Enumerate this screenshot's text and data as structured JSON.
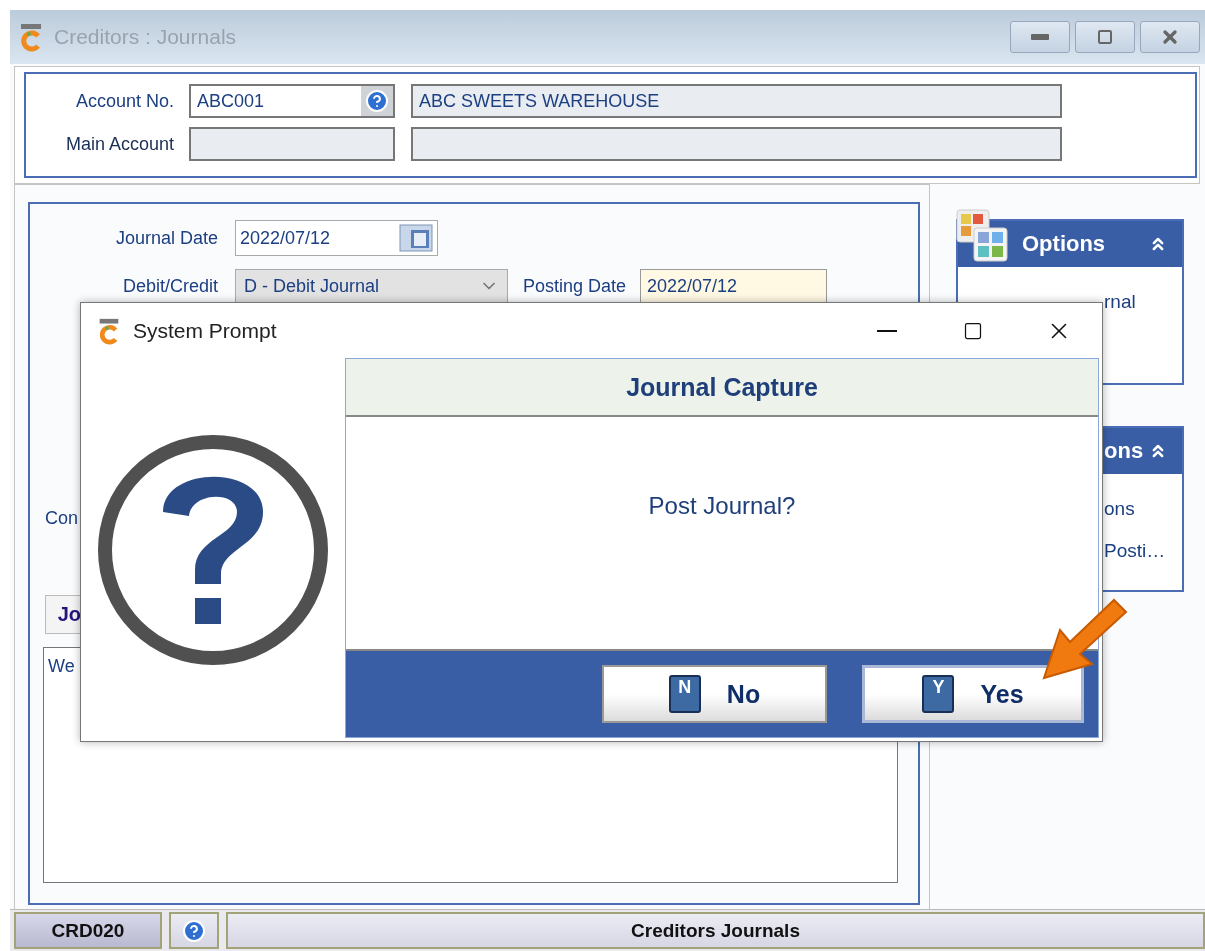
{
  "window": {
    "title": "Creditors : Journals"
  },
  "account": {
    "account_no_label": "Account No.",
    "account_no": "ABC001",
    "account_name": "ABC SWEETS WAREHOUSE",
    "main_account_label": "Main Account"
  },
  "journal": {
    "journal_date_label": "Journal Date",
    "journal_date": "2022/07/12",
    "debit_credit_label": "Debit/Credit",
    "debit_credit": "D - Debit Journal",
    "posting_date_label": "Posting Date",
    "posting_date": "2022/07/12",
    "partial_label": "Con",
    "tab": "Jo",
    "notes": "We"
  },
  "sidebar": {
    "panels": [
      {
        "title": "Options",
        "expanded": true,
        "items": [
          "rnal"
        ]
      },
      {
        "title": "ons",
        "expanded": true,
        "items": [
          "ons",
          "Posti…"
        ]
      }
    ]
  },
  "dialog": {
    "title": "System Prompt",
    "heading": "Journal Capture",
    "message": "Post Journal?",
    "buttons": [
      {
        "key": "N",
        "label": "No",
        "selected": false
      },
      {
        "key": "Y",
        "label": "Yes",
        "selected": true
      }
    ]
  },
  "status_bar": {
    "code": "CRD020",
    "title": "Creditors Journals"
  }
}
